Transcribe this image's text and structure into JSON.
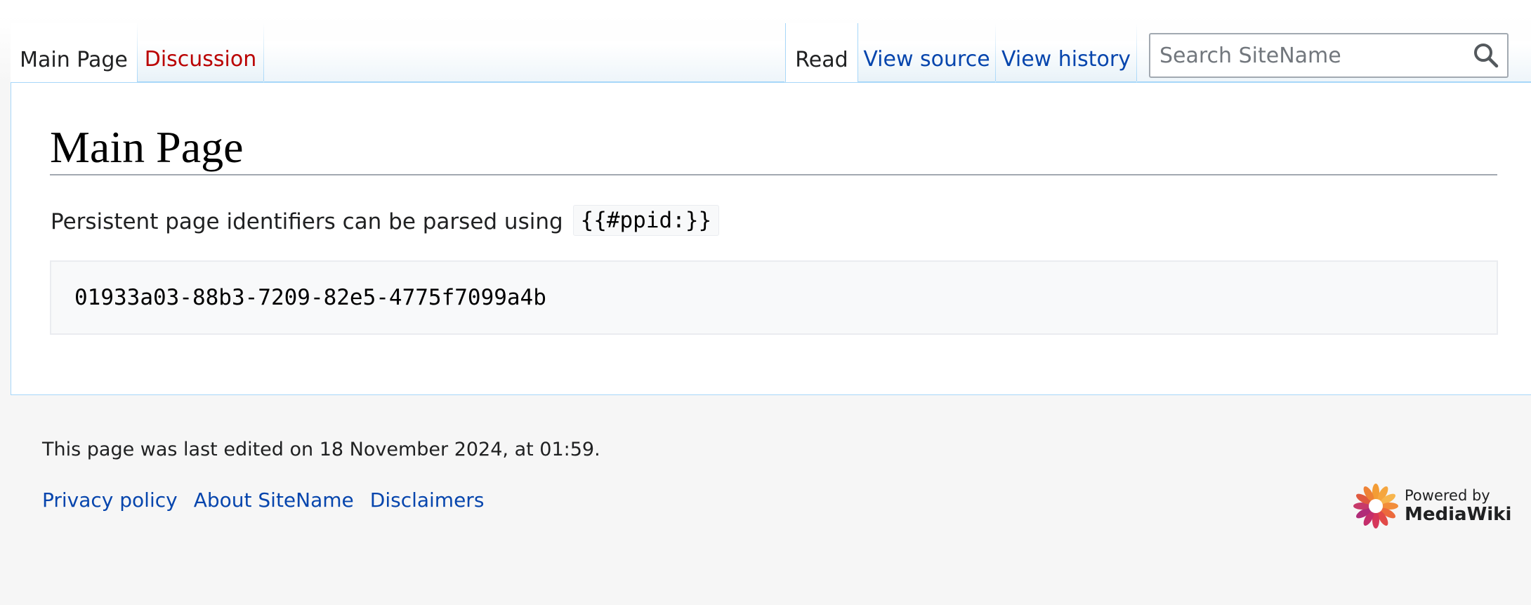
{
  "left_tabs": {
    "page_tab_label": "Main Page",
    "talk_tab_label": "Discussion"
  },
  "right_tabs": {
    "read_label": "Read",
    "view_source_label": "View source",
    "view_history_label": "View history"
  },
  "search": {
    "placeholder": "Search SiteName",
    "value": ""
  },
  "content": {
    "page_title": "Main Page",
    "paragraph_text": "Persistent page identifiers can be parsed using",
    "inline_code": "{{#ppid:}}",
    "preformatted": "01933a03-88b3-7209-82e5-4775f7099a4b"
  },
  "footer": {
    "last_modified": "This page was last edited on 18 November 2024, at 01:59.",
    "links": [
      "Privacy policy",
      "About SiteName",
      "Disclaimers"
    ],
    "powered_by_line1": "Powered by",
    "powered_by_line2": "MediaWiki"
  },
  "colors": {
    "link": "#0645ad",
    "new_link": "#ba0000",
    "tab_border": "#a7d7f9",
    "footer_background": "#f6f6f6"
  }
}
